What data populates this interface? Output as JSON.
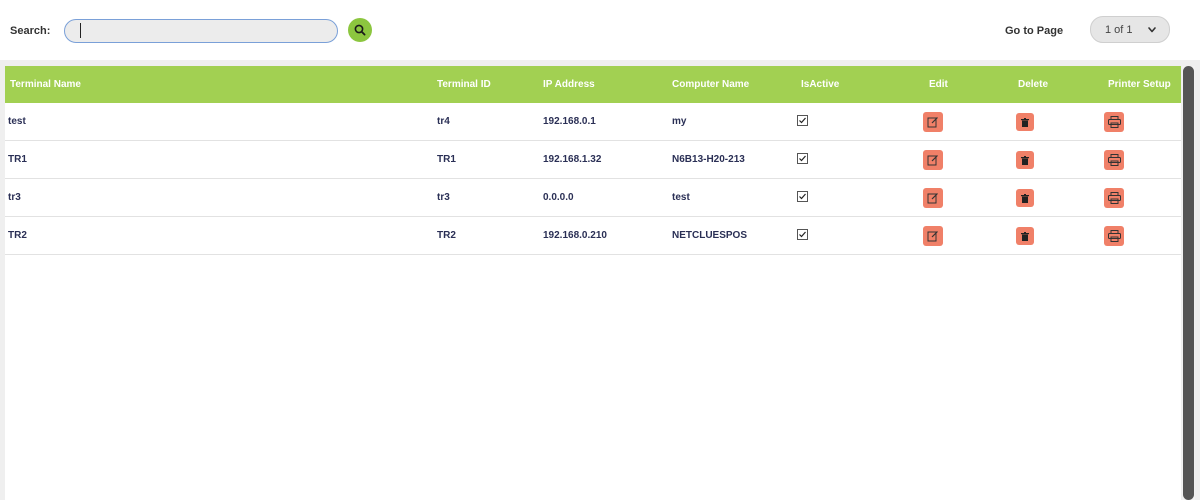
{
  "toolbar": {
    "search_label": "Search:",
    "search_value": "",
    "search_placeholder": "",
    "goto_label": "Go to Page",
    "page_value": "1 of 1"
  },
  "table": {
    "columns": [
      "Terminal Name",
      "Terminal ID",
      "IP Address",
      "Computer Name",
      "IsActive",
      "Edit",
      "Delete",
      "Printer Setup"
    ],
    "rows": [
      {
        "name": "test",
        "id": "tr4",
        "ip": "192.168.0.1",
        "computer": "my",
        "active": true
      },
      {
        "name": "TR1",
        "id": "TR1",
        "ip": "192.168.1.32",
        "computer": "N6B13-H20-213",
        "active": true
      },
      {
        "name": "tr3",
        "id": "tr3",
        "ip": "0.0.0.0",
        "computer": "test",
        "active": true
      },
      {
        "name": "TR2",
        "id": "TR2",
        "ip": "192.168.0.210",
        "computer": "NETCLUESPOS",
        "active": true
      }
    ]
  },
  "icons": {
    "search": "search-icon",
    "dropdown": "chevron-down-icon",
    "edit": "edit-icon",
    "delete": "trash-icon",
    "printer": "printer-icon",
    "checkbox": "checkbox-checked-icon"
  },
  "colors": {
    "header_bg": "#a2d052",
    "search_button": "#8cc63f",
    "action_button": "#f08068",
    "cell_text": "#2a2f55"
  }
}
